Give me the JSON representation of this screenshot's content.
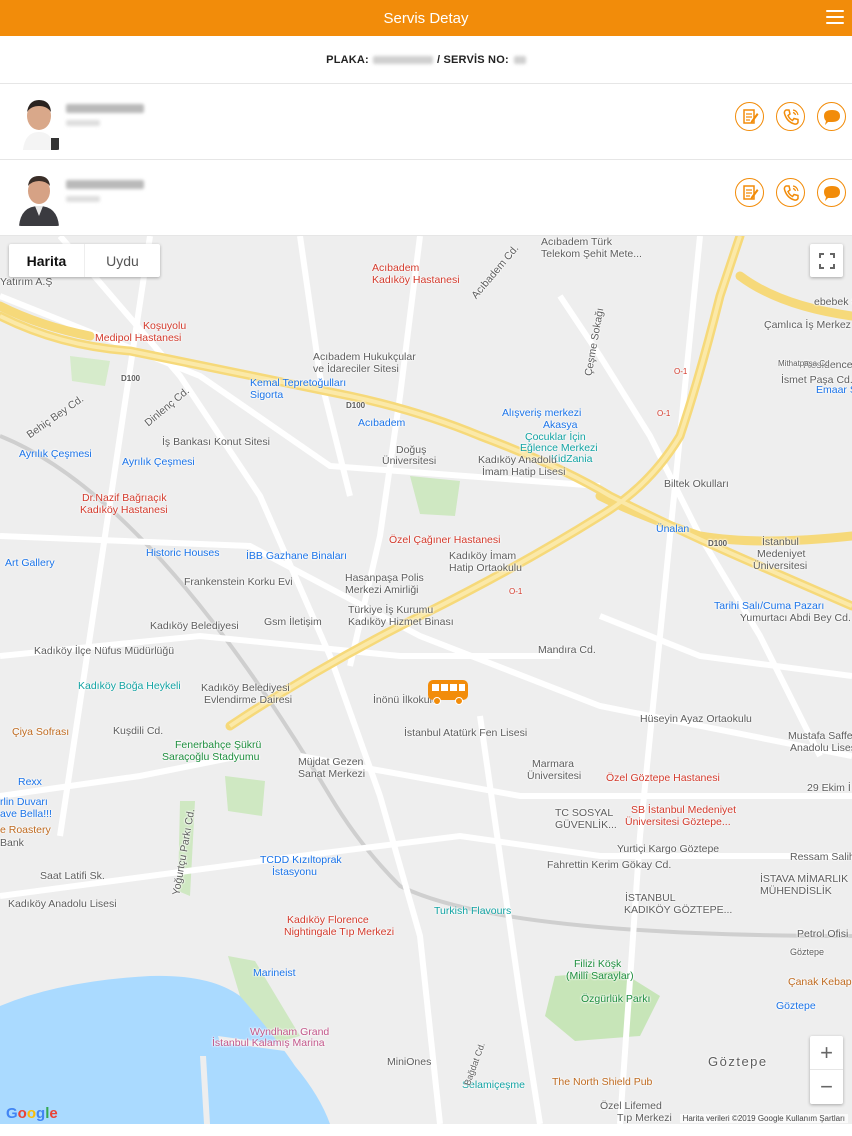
{
  "header": {
    "title": "Servis Detay",
    "menu_icon": "hamburger-menu-icon"
  },
  "service": {
    "plate_label": "PLAKA:",
    "service_no_label": "/ SERVİS NO:"
  },
  "people": [
    {
      "icons": [
        "document-edit-icon",
        "phone-icon",
        "chat-bubble-icon"
      ]
    },
    {
      "icons": [
        "document-edit-icon",
        "phone-icon",
        "chat-bubble-icon"
      ]
    }
  ],
  "map": {
    "type_map": "Harita",
    "type_satellite": "Uydu",
    "fullscreen_icon": "fullscreen-icon",
    "zoom_in": "+",
    "zoom_out": "−",
    "logo": "Google",
    "attribution": "Harita verileri ©2019 Google   Kullanım Şartları",
    "accent": "#f28c0a",
    "labels": [
      {
        "t": "Acıbadem Türk",
        "c": "gray"
      },
      {
        "t": "Telekom Şehit Mete...",
        "c": "gray"
      },
      {
        "t": "Acıbadem",
        "c": "red"
      },
      {
        "t": "Kadıköy Hastanesi",
        "c": "red"
      },
      {
        "t": "Koşuyolu",
        "c": "red"
      },
      {
        "t": "Medipol Hastanesi",
        "c": "red"
      },
      {
        "t": "Acıbadem Hukukçular",
        "c": "gray"
      },
      {
        "t": "ve İdareciler Sitesi",
        "c": "gray"
      },
      {
        "t": "Kemal Tepretoğulları",
        "c": "blue"
      },
      {
        "t": "Sigorta",
        "c": "blue"
      },
      {
        "t": "Alışveriş merkezi",
        "c": "blue"
      },
      {
        "t": "Akasya",
        "c": "blue"
      },
      {
        "t": "Çocuklar İçin",
        "c": "teal"
      },
      {
        "t": "Eğlence Merkezi",
        "c": "teal"
      },
      {
        "t": "KidZania",
        "c": "teal"
      },
      {
        "t": "Acıbadem",
        "c": "blue"
      },
      {
        "t": "Doğuş",
        "c": "gray"
      },
      {
        "t": "Üniversitesi",
        "c": "gray"
      },
      {
        "t": "Kadıköy Anadolu",
        "c": "gray"
      },
      {
        "t": "İmam Hatip Lisesi",
        "c": "gray"
      },
      {
        "t": "Biltek Okulları",
        "c": "gray"
      },
      {
        "t": "İş Bankası Konut Sitesi",
        "c": "gray"
      },
      {
        "t": "Ayrılık Çeşmesi",
        "c": "blue"
      },
      {
        "t": "Ayrılık Çeşmesi",
        "c": "blue"
      },
      {
        "t": "Dr.Nazif Bağrıaçık",
        "c": "red"
      },
      {
        "t": "Kadıköy Hastanesi",
        "c": "red"
      },
      {
        "t": "Özel Çağıner Hastanesi",
        "c": "red"
      },
      {
        "t": "Ünalan",
        "c": "blue"
      },
      {
        "t": "İstanbul",
        "c": "gray"
      },
      {
        "t": "Medeniyet",
        "c": "gray"
      },
      {
        "t": "Üniversitesi",
        "c": "gray"
      },
      {
        "t": "Historic Houses",
        "c": "blue"
      },
      {
        "t": "İBB Gazhane Binaları",
        "c": "blue"
      },
      {
        "t": "Kadıköy İmam",
        "c": "gray"
      },
      {
        "t": "Hatip Ortaokulu",
        "c": "gray"
      },
      {
        "t": "Art Gallery",
        "c": "blue"
      },
      {
        "t": "Frankenstein Korku Evi",
        "c": "gray"
      },
      {
        "t": "Hasanpaşa Polis",
        "c": "gray"
      },
      {
        "t": "Merkezi Amirliği",
        "c": "gray"
      },
      {
        "t": "Tarihi Salı/Cuma Pazarı",
        "c": "blue"
      },
      {
        "t": "Türkiye İş Kurumu",
        "c": "gray"
      },
      {
        "t": "Kadıköy Hizmet Binası",
        "c": "gray"
      },
      {
        "t": "Kadıköy Belediyesi",
        "c": "gray"
      },
      {
        "t": "Gsm İletişim",
        "c": "gray"
      },
      {
        "t": "Kadıköy İlçe Nüfus Müdürlüğü",
        "c": "gray"
      },
      {
        "t": "Yumurtacı Abdi Bey Cd.",
        "c": "gray"
      },
      {
        "t": "Mandıra Cd.",
        "c": "gray"
      },
      {
        "t": "Kadıköy Boğa Heykeli",
        "c": "teal"
      },
      {
        "t": "Kadıköy Belediyesi",
        "c": "gray"
      },
      {
        "t": "Evlendirme Dairesi",
        "c": "gray"
      },
      {
        "t": "İnönü İlkokulu",
        "c": "gray"
      },
      {
        "t": "Hüseyin Ayaz Ortaokulu",
        "c": "gray"
      },
      {
        "t": "Çiya Sofrası",
        "c": "brown"
      },
      {
        "t": "Kuşdili Cd.",
        "c": "gray"
      },
      {
        "t": "Fenerbahçe Şükrü",
        "c": "green"
      },
      {
        "t": "Saraçoğlu Stadyumu",
        "c": "green"
      },
      {
        "t": "İstanbul Atatürk Fen Lisesi",
        "c": "gray"
      },
      {
        "t": "Mustafa Saffet",
        "c": "gray"
      },
      {
        "t": "Anadolu Lisesi",
        "c": "gray"
      },
      {
        "t": "Müjdat Gezen",
        "c": "gray"
      },
      {
        "t": "Sanat Merkezi",
        "c": "gray"
      },
      {
        "t": "Marmara",
        "c": "gray"
      },
      {
        "t": "Üniversitesi",
        "c": "gray"
      },
      {
        "t": "Özel Göztepe Hastanesi",
        "c": "red"
      },
      {
        "t": "Rexx",
        "c": "blue"
      },
      {
        "t": "29 Ekim İ",
        "c": "gray"
      },
      {
        "t": "rlin Duvarı",
        "c": "blue"
      },
      {
        "t": "ave Bella!!!",
        "c": "blue"
      },
      {
        "t": "SB İstanbul Medeniyet",
        "c": "red"
      },
      {
        "t": "Üniversitesi Göztepe...",
        "c": "red"
      },
      {
        "t": "TC SOSYAL",
        "c": "gray"
      },
      {
        "t": "GÜVENLİK...",
        "c": "gray"
      },
      {
        "t": "e Roastery",
        "c": "brown"
      },
      {
        "t": "Bank",
        "c": "gray"
      },
      {
        "t": "Yurtiçi Kargo Göztepe",
        "c": "gray"
      },
      {
        "t": "TCDD Kızıltoprak",
        "c": "blue"
      },
      {
        "t": "İstasyonu",
        "c": "blue"
      },
      {
        "t": "Fahrettin Kerim Gökay Cd.",
        "c": "gray"
      },
      {
        "t": "Ressam Salih E",
        "c": "gray"
      },
      {
        "t": "Saat Latifi Sk.",
        "c": "gray"
      },
      {
        "t": "İSTAVA MİMARLIK",
        "c": "gray"
      },
      {
        "t": "MÜHENDİSLİK",
        "c": "gray"
      },
      {
        "t": "İSTANBUL",
        "c": "gray"
      },
      {
        "t": "KADIKÖY GÖZTEPE...",
        "c": "gray"
      },
      {
        "t": "Kadıköy Anadolu Lisesi",
        "c": "gray"
      },
      {
        "t": "Turkish Flavours",
        "c": "teal"
      },
      {
        "t": "Kadıköy Florence",
        "c": "red"
      },
      {
        "t": "Nightingale Tıp Merkezi",
        "c": "red"
      },
      {
        "t": "Petrol Ofisi",
        "c": "gray"
      },
      {
        "t": "Filizi Köşk",
        "c": "green"
      },
      {
        "t": "(Millî Saraylar)",
        "c": "green"
      },
      {
        "t": "Marineist",
        "c": "blue"
      },
      {
        "t": "Çanak Kebap",
        "c": "brown"
      },
      {
        "t": "Özgürlük Parkı",
        "c": "green"
      },
      {
        "t": "Göztepe",
        "c": "blue"
      },
      {
        "t": "Wyndham Grand",
        "c": "pink"
      },
      {
        "t": "İstanbul Kalamış Marina",
        "c": "pink"
      },
      {
        "t": "MiniOnes",
        "c": "gray"
      },
      {
        "t": "Göztepe",
        "c": "gray"
      },
      {
        "t": "Selamiçeşme",
        "c": "teal"
      },
      {
        "t": "The North Shield Pub",
        "c": "brown"
      },
      {
        "t": "Özel Lifemed",
        "c": "gray"
      },
      {
        "t": "Tıp Merkezi",
        "c": "gray"
      },
      {
        "t": "Çamlıca İş Merkez",
        "c": "gray"
      },
      {
        "t": "Residence",
        "c": "gray"
      },
      {
        "t": "Emaar S",
        "c": "blue"
      },
      {
        "t": "ebebek Ça",
        "c": "gray"
      },
      {
        "t": "Yatırım A.Ş",
        "c": "gray"
      },
      {
        "t": "D100",
        "c": "gray"
      },
      {
        "t": "D100",
        "c": "gray"
      },
      {
        "t": "D100",
        "c": "gray"
      },
      {
        "t": "O-1",
        "c": "gray"
      },
      {
        "t": "O-1",
        "c": "gray"
      },
      {
        "t": "O-1",
        "c": "gray"
      },
      {
        "t": "Behiç Bey Cd.",
        "c": "gray"
      },
      {
        "t": "Çeşme Sokağı",
        "c": "gray"
      },
      {
        "t": "Acıbadem Cd.",
        "c": "gray"
      },
      {
        "t": "Dinlenç Cd.",
        "c": "gray"
      },
      {
        "t": "İsmet Paşa Cd.",
        "c": "gray"
      },
      {
        "t": "Mithatpaşa Cd.",
        "c": "gray"
      },
      {
        "t": "Yoğurtçu Parkı Cd.",
        "c": "gray"
      },
      {
        "t": "Bağdat Cd.",
        "c": "gray"
      },
      {
        "t": "Göztepe",
        "c": "gray"
      }
    ]
  }
}
